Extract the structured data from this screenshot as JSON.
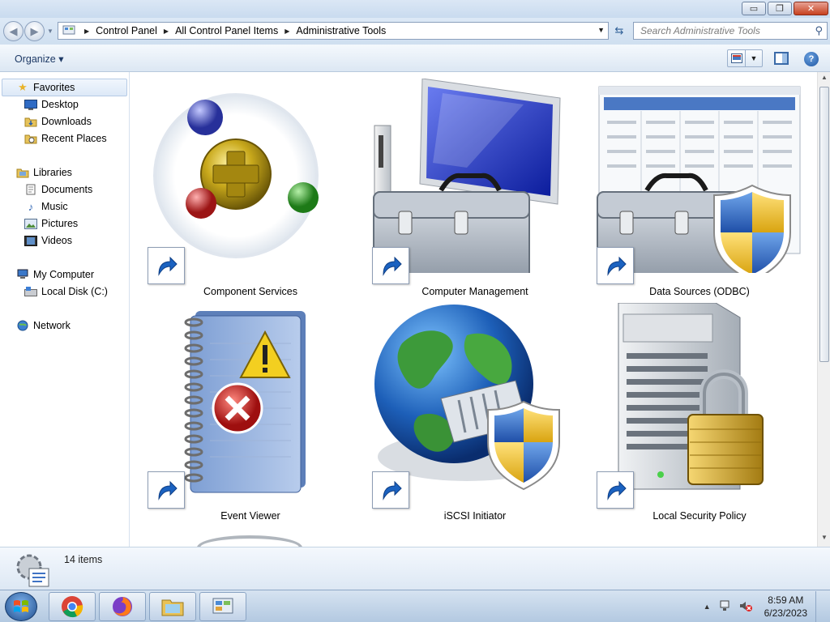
{
  "window": {
    "caption": {
      "minimize": "▭",
      "restore": "❐",
      "close": "✕"
    }
  },
  "address": {
    "crumbs": [
      "Control Panel",
      "All Control Panel Items",
      "Administrative Tools"
    ],
    "search_placeholder": "Search Administrative Tools"
  },
  "toolbar": {
    "organize_label": "Organize ▾",
    "help": "?"
  },
  "nav": {
    "favorites": "Favorites",
    "desktop": "Desktop",
    "downloads": "Downloads",
    "recent": "Recent Places",
    "libraries": "Libraries",
    "documents": "Documents",
    "music": "Music",
    "pictures": "Pictures",
    "videos": "Videos",
    "computer": "My Computer",
    "local_disk": "Local Disk (C:)",
    "network": "Network"
  },
  "items": [
    {
      "label": "Component Services",
      "icon": "component-services-icon"
    },
    {
      "label": "Computer Management",
      "icon": "computer-management-icon"
    },
    {
      "label": "Data Sources (ODBC)",
      "icon": "data-sources-icon"
    },
    {
      "label": "Event Viewer",
      "icon": "event-viewer-icon"
    },
    {
      "label": "iSCSI Initiator",
      "icon": "iscsi-initiator-icon"
    },
    {
      "label": "Local Security Policy",
      "icon": "local-security-policy-icon"
    }
  ],
  "status": {
    "count": "14 items"
  },
  "clock": {
    "time": "8:59 AM",
    "date": "6/23/2023"
  },
  "colors": {
    "accent": "#1f4d8c",
    "selection": "#dde9f7"
  }
}
